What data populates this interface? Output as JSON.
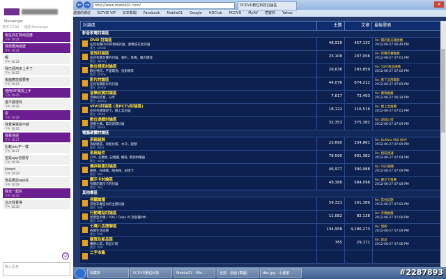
{
  "messenger": {
    "subtitle": "Messenger",
    "date_line": "昨天 17:54 ・ 透過 Messenger",
    "messages": [
      {
        "who": "me",
        "text": "現在你打算用甚麼",
        "time": "下午 10:24"
      },
      {
        "who": "me",
        "text": "我想要用甚麼",
        "time": "下午 10:24"
      },
      {
        "who": "them",
        "text": "喔",
        "time": "下午 10:24"
      },
      {
        "who": "them",
        "text": "我已經用多上手了",
        "time": "下午 10:25"
      },
      {
        "who": "them",
        "text": "後面應該都要用",
        "time": "下午 10:25"
      },
      {
        "who": "me",
        "text": "他用VIP電視上手",
        "time": "下午 10:25"
      },
      {
        "who": "them",
        "text": "還不錯很有",
        "time": "下午 10:26"
      },
      {
        "who": "me",
        "text": "恩",
        "time": "下午 10:26"
      },
      {
        "who": "them",
        "text": "我覺得電視不錯",
        "time": "下午 10:26"
      },
      {
        "who": "me",
        "text": "我看他說",
        "time": "下午 10:27"
      },
      {
        "who": "them",
        "text": "比較mic不一樣",
        "time": "下午 10:27"
      },
      {
        "who": "them",
        "text": "但是app也很好",
        "time": "下午 10:28"
      },
      {
        "who": "them",
        "text": "kinect",
        "time": "下午 10:29"
      },
      {
        "who": "them",
        "text": "他是應該app好",
        "time": "下午 10:29"
      },
      {
        "who": "me",
        "text": "我也一起的",
        "time": "下午 10:30"
      },
      {
        "who": "them",
        "text": "這次我覺得",
        "time": "下午 10:30"
      }
    ],
    "input_placeholder": "輸入訊息"
  },
  "browser": {
    "url": "http://www.mobile01.com/",
    "tab_title": "PCDVD數位科技討論區",
    "nav_back": "←",
    "nav_forward": "→",
    "close": "✕",
    "bookmarks": [
      "建議的網站",
      "ELTVIE VIP",
      "日本新聞",
      "Facebook",
      "Mobile01",
      "Google",
      "HDClub",
      "PCDVD",
      "MyAV",
      "痞客邦",
      "Yahoo"
    ]
  },
  "table": {
    "headers": {
      "forum": "討論區",
      "topics": "主題",
      "posts": "文章",
      "last": "最後發表"
    },
    "sections": [
      {
        "title": "影音家電討論區",
        "forums": [
          {
            "name": "DVD 討論區",
            "desc": "任何有關DVD的規格討論，都歡迎在此討論",
            "mod": "版主: pdvd1",
            "topics": "48,918",
            "posts": "457,132",
            "last_title": "Re: 關於藍光播放機",
            "last_info": "2012-06-27 06:49 PM"
          },
          {
            "name": "音效討論區",
            "desc": "任何有關音響的討論，喇叭，耳機，擴大機等",
            "mod": "版主: ajoncy",
            "topics": "23,108",
            "posts": "207,056",
            "last_title": "Re: 新購音響推薦",
            "last_info": "2012-06-27 07:01 PM"
          },
          {
            "name": "數位視訊討論區",
            "desc": "數位視訊，平面電視，投影機等",
            "mod": "版主: jimmy",
            "topics": "29,636",
            "posts": "293,859",
            "last_title": "Re: 50吋液晶選購",
            "last_info": "2012-06-27 07:06 PM"
          },
          {
            "name": "影片討論區",
            "desc": "任何有關影片的討論",
            "mod": "版主: jimmy",
            "topics": "44,076",
            "posts": "674,212",
            "last_title": "Re: 看了這部電影",
            "last_info": "2012-06-27 07:09 PM"
          },
          {
            "name": "音樂欣賞討論區",
            "desc": "音樂的欣賞，分享",
            "mod": "版主: ajoncy",
            "topics": "7,617",
            "posts": "73,493",
            "last_title": "Re: 聽歌推薦",
            "last_info": "2012-06-27 06:34 PM"
          },
          {
            "name": "VIVO討論區 (含PCTV討論區)",
            "desc": "任何有關電視卡，機上盒討論",
            "mod": "版主: kkkkk",
            "topics": "18,122",
            "posts": "116,516",
            "last_title": "Re: 機上盒推薦",
            "last_info": "2012-06-27 07:01 PM"
          },
          {
            "name": "數位遊戲討論區",
            "desc": "遊戲主機，電玩遊戲討論",
            "mod": "版主: kkkkk",
            "topics": "32,353",
            "posts": "375,382",
            "last_title": "Re: 遊戲心得",
            "last_info": "2012-06-27 07:09 PM"
          }
        ]
      },
      {
        "title": "電腦硬體討論區",
        "forums": [
          {
            "name": "系統組裝",
            "desc": "系統組裝，效能比較，水冷，超頻",
            "mod": "版主: wmu",
            "topics": "23,690",
            "posts": "334,861",
            "last_title": "Re: Buffalo 980 WAP",
            "last_info": "2012-06-27 07:09 PM"
          },
          {
            "name": "系統組件",
            "desc": "CPU, 主機板, 記憶體, 機殼, 電源供應器",
            "mod": "版主: wmu",
            "topics": "78,590",
            "posts": "901,382",
            "last_title": "Re: 組裝建議",
            "last_info": "2012-06-27 07:04 PM"
          },
          {
            "name": "儲存裝置討論區",
            "desc": "硬碟，光碟機，隨身碟，記憶卡",
            "mod": "版主: oka",
            "topics": "46,977",
            "posts": "390,988",
            "last_title": "Re: SSD選購",
            "last_info": "2012-06-27 07:09 PM"
          },
          {
            "name": "顯示卡討論區",
            "desc": "有關於顯示卡的討論",
            "mod": "版主: oka",
            "topics": "49,386",
            "posts": "584,098",
            "last_title": "Re: 顯示卡推薦",
            "last_info": "2012-06-27 07:08 PM"
          }
        ]
      },
      {
        "title": "其他專區",
        "forums": [
          {
            "name": "視聽論壇",
            "desc": "其他非專區內的主題討論",
            "mod": "版主: tmh",
            "topics": "59,323",
            "posts": "201,386",
            "last_title": "Re: 其他話題",
            "last_info": "2012-06-27 07:02 PM"
          },
          {
            "name": "行動電話討論區",
            "desc": "智慧型手機 / PDA / Table PC及各種PMI",
            "mod": "版主: tmh",
            "topics": "11,082",
            "posts": "82,138",
            "last_title": "Re: 手機推薦",
            "last_info": "2012-06-27 07:09 PM"
          },
          {
            "name": "七嘴八舌閒聊區",
            "desc": "各類生活話題",
            "mod": "版主: tmh",
            "topics": "134,958",
            "posts": "4,186,273",
            "last_title": "Re: 閒聊",
            "last_info": "2012-06-27 07:09 PM"
          },
          {
            "name": "購買及新品區",
            "desc": "購買心得，新品介紹",
            "mod": "版主: tmh",
            "topics": "765",
            "posts": "29,171",
            "last_title": "Re: 新品",
            "last_info": "2012-06-27 07:06 PM"
          },
          {
            "name": "二手市集",
            "desc": "",
            "mod": "",
            "topics": "",
            "posts": "",
            "last_title": "",
            "last_info": ""
          }
        ]
      }
    ]
  },
  "taskbar": {
    "tasks": [
      "收藏夾",
      "PCDVD數位科技",
      "Mobile01 - Win...",
      "全部 - 桌面 (截圖)",
      "dbs.jpg - 小畫家"
    ]
  },
  "watermark": "#2287893"
}
